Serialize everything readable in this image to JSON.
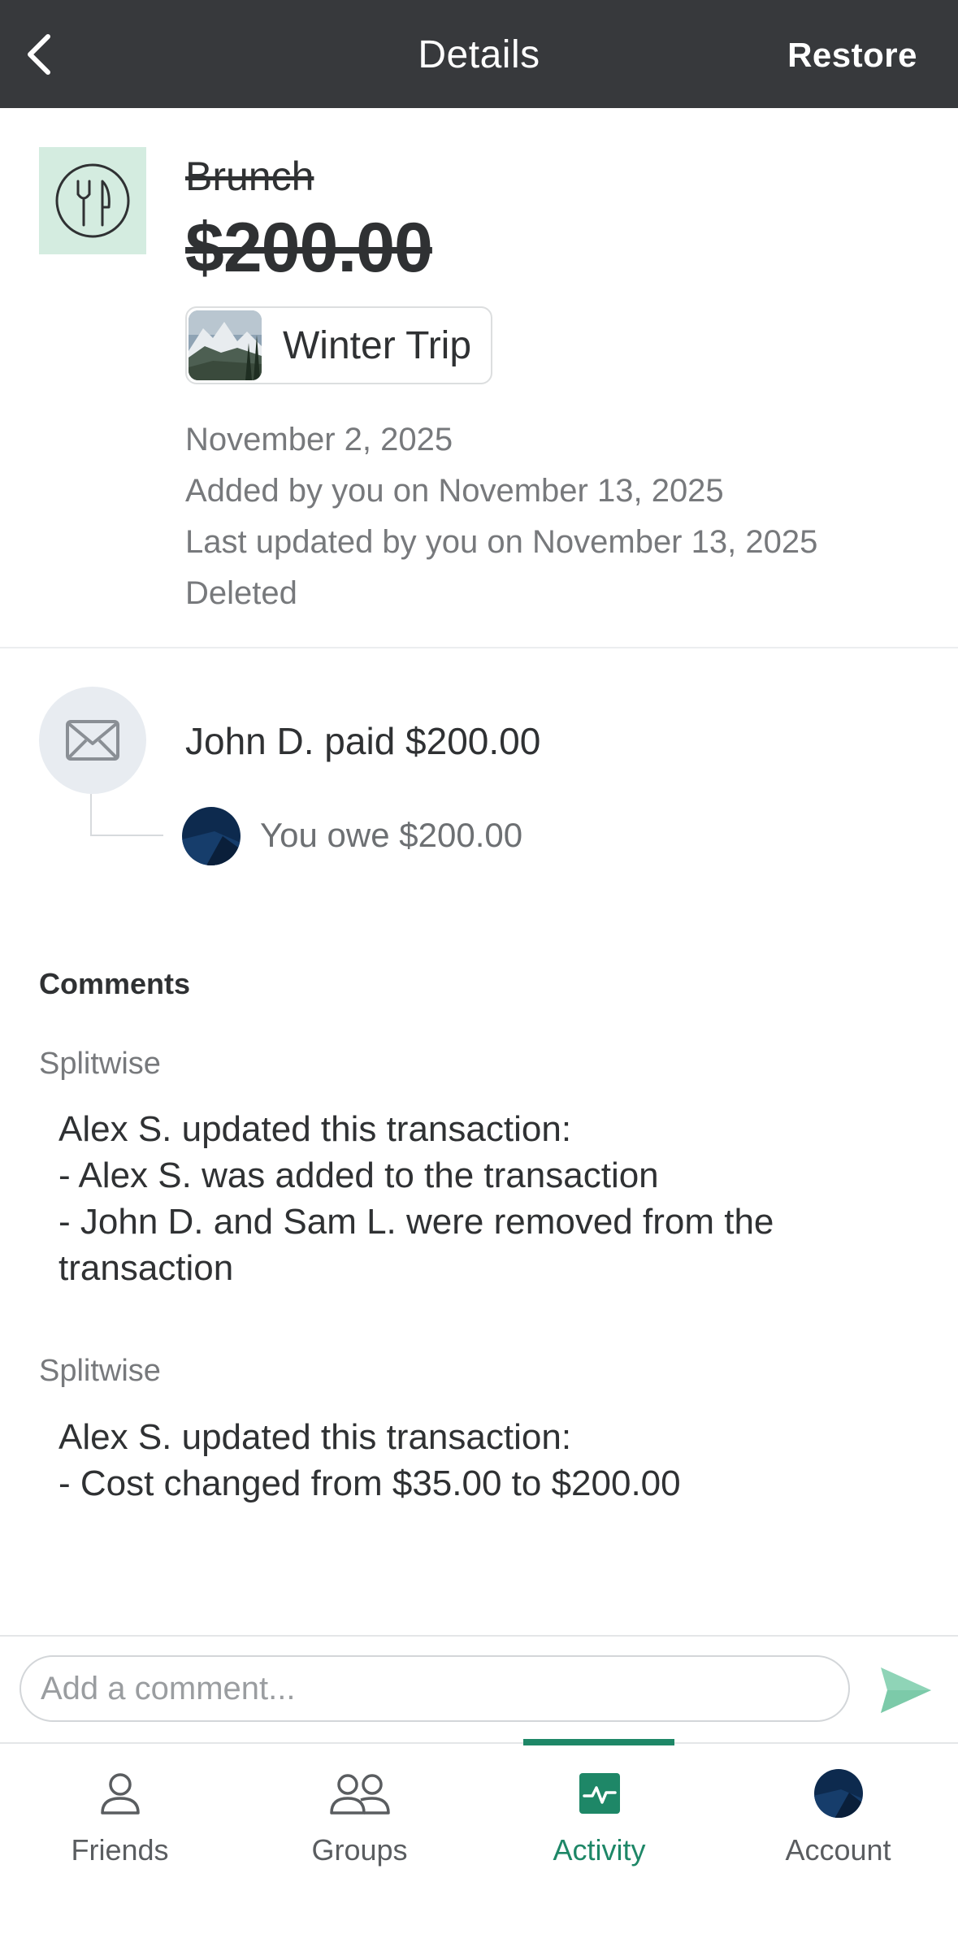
{
  "header": {
    "title": "Details",
    "restore_label": "Restore"
  },
  "expense": {
    "title": "Brunch",
    "amount": "$200.00",
    "category_icon": "fork-knife-icon",
    "group_name": "Winter Trip",
    "date": "November 2, 2025",
    "added_by": "Added by you on November 13, 2025",
    "updated_by": "Last updated by you on November 13, 2025",
    "status": "Deleted"
  },
  "payment": {
    "paid_text": "John D. paid $200.00",
    "owe_text": "You owe $200.00"
  },
  "comments": {
    "label": "Comments",
    "items": [
      {
        "author": "Splitwise",
        "body": "Alex S. updated this transaction:\n- Alex S. was added to the transaction\n- John D. and Sam L. were removed from the\ntransaction"
      },
      {
        "author": "Splitwise",
        "body": "Alex S. updated this transaction:\n- Cost changed from $35.00 to $200.00"
      }
    ]
  },
  "comment_input": {
    "placeholder": "Add a comment...",
    "value": ""
  },
  "tabs": [
    {
      "label": "Friends",
      "icon": "person-icon"
    },
    {
      "label": "Groups",
      "icon": "people-icon"
    },
    {
      "label": "Activity",
      "icon": "activity-icon",
      "active": true
    },
    {
      "label": "Account",
      "icon": "avatar-icon"
    }
  ],
  "colors": {
    "header_bg": "#37393c",
    "accent": "#1e8767",
    "category_bg": "#d4ece0",
    "send_icon": "#8fd4b7"
  }
}
